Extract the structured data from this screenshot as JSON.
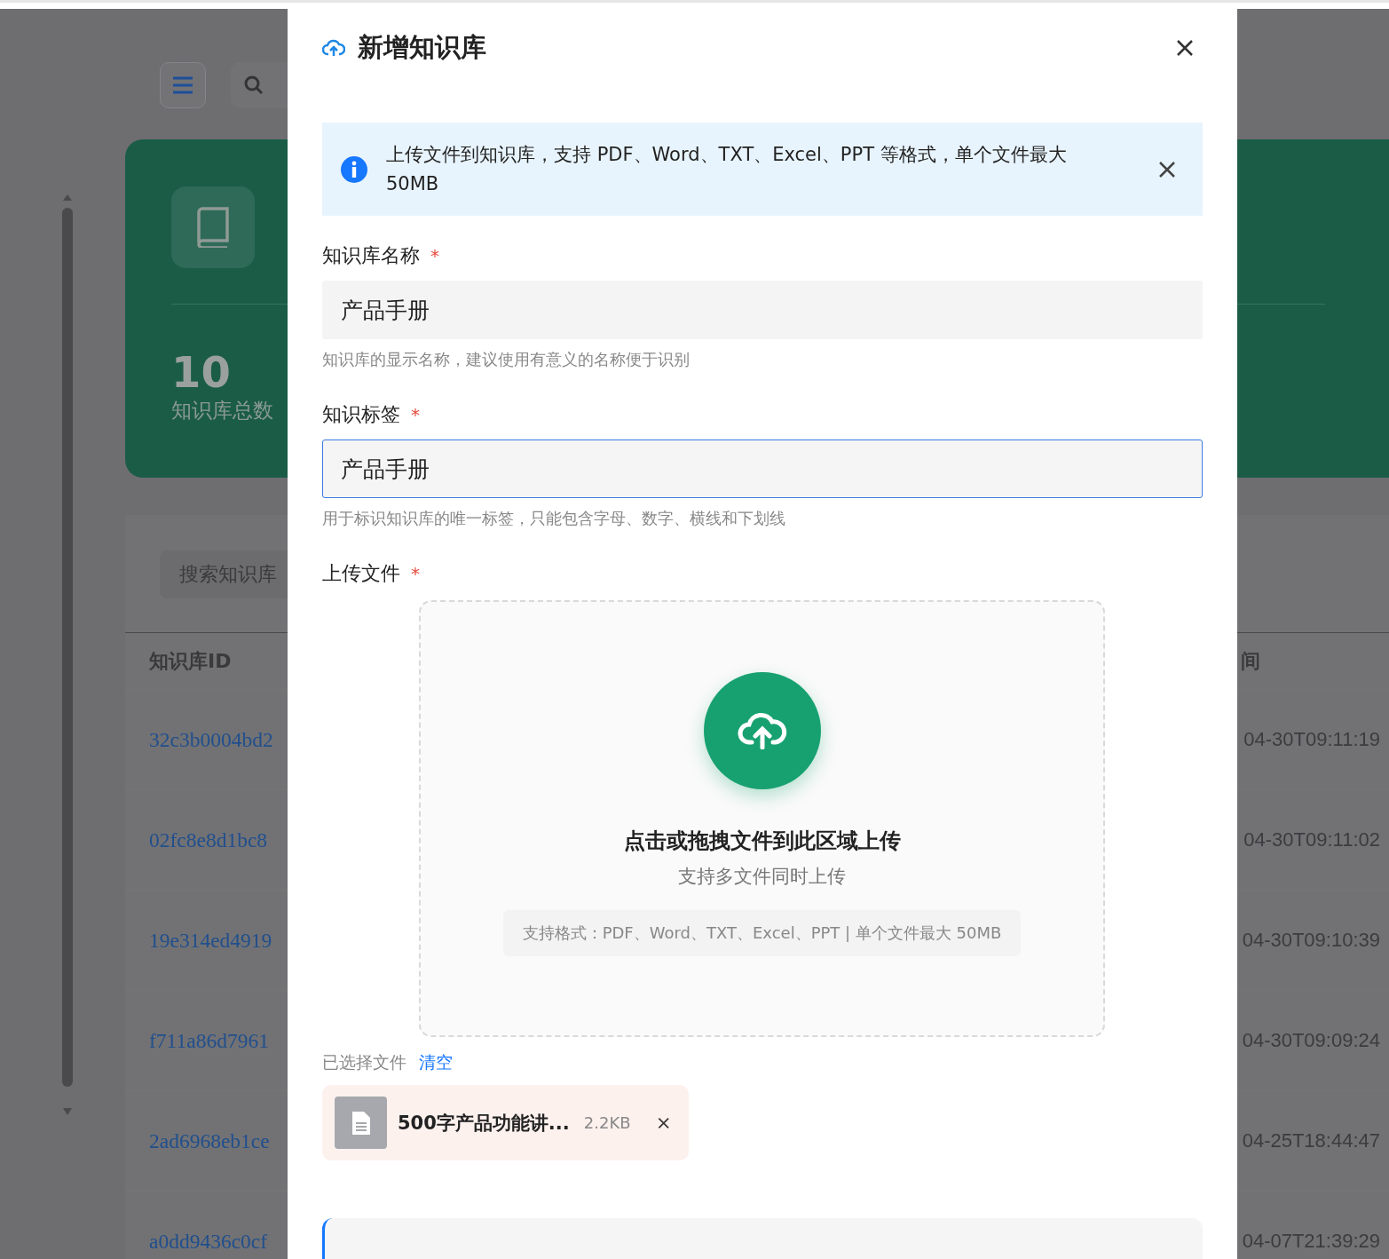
{
  "background": {
    "stat": {
      "value": "10",
      "label": "知识库总数"
    },
    "search_placeholder": "搜索知识库",
    "table": {
      "columns": [
        "知识库ID",
        "间"
      ],
      "rows": [
        {
          "id": "32c3b0004bd2",
          "time": "04-30T09:11:19"
        },
        {
          "id": "02fc8e8d1bc8",
          "time": "04-30T09:11:02"
        },
        {
          "id": "19e314ed4919",
          "time": "04-30T09:10:39"
        },
        {
          "id": "f711a86d7961",
          "time": "04-30T09:09:24"
        },
        {
          "id": "2ad6968eb1ce",
          "time": "04-25T18:44:47"
        },
        {
          "id": "a0dd9436c0cf",
          "time": "04-07T21:39:29"
        }
      ]
    }
  },
  "dialog": {
    "title": "新增知识库",
    "alert": {
      "text": "上传文件到知识库，支持 PDF、Word、TXT、Excel、PPT 等格式，单个文件最大 50MB"
    },
    "fields": [
      {
        "label": "知识库名称",
        "required_mark": "*",
        "value": "产品手册",
        "hint": "知识库的显示名称，建议使用有意义的名称便于识别",
        "focused": false
      },
      {
        "label": "知识标签",
        "required_mark": "*",
        "value": "产品手册",
        "hint": "用于标识知识库的唯一标签，只能包含字母、数字、横线和下划线",
        "focused": true
      }
    ],
    "upload": {
      "label": "上传文件",
      "required_mark": "*",
      "title": "点击或拖拽文件到此区域上传",
      "subtitle": "支持多文件同时上传",
      "formats": "支持格式：PDF、Word、TXT、Excel、PPT | 单个文件最大 50MB"
    },
    "selected": {
      "label": "已选择文件",
      "clear": "清空",
      "files": [
        {
          "name": "500字产品功能讲...",
          "size": "2.2KB"
        }
      ]
    }
  }
}
